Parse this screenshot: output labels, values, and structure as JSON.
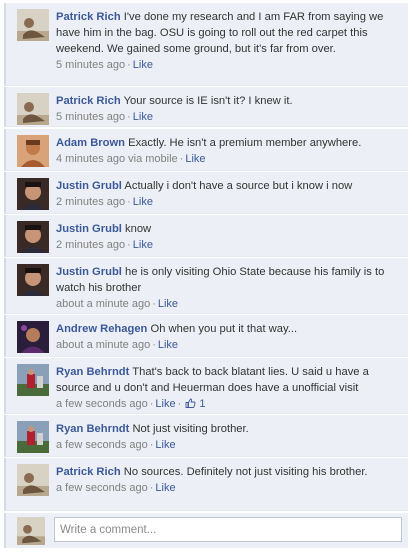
{
  "comments": [
    {
      "author": "Patrick Rich",
      "text": "I've done my research and I am FAR from saying we have him in the bag. OSU is going to roll out the red carpet this weekend. We gained some ground, but it's far from over.",
      "time": "5 minutes ago",
      "like": "Like",
      "avatar": "patrick-rich-avatar"
    },
    {
      "author": "Patrick Rich",
      "text": "Your source is IE isn't it? I knew it.",
      "time": "5 minutes ago",
      "like": "Like",
      "avatar": "patrick-rich-avatar"
    },
    {
      "author": "Adam Brown",
      "text": "Exactly. He isn't a premium member anywhere.",
      "time": "4 minutes ago via mobile",
      "like": "Like",
      "avatar": "adam-brown-avatar"
    },
    {
      "author": "Justin Grubl",
      "text": "Actually i don't have a source but i know i now",
      "time": "2 minutes ago",
      "like": "Like",
      "avatar": "justin-grubl-avatar"
    },
    {
      "author": "Justin Grubl",
      "text": "know",
      "time": "2 minutes ago",
      "like": "Like",
      "avatar": "justin-grubl-avatar"
    },
    {
      "author": "Justin Grubl",
      "text": "he is only visiting Ohio State because his family is to watch his brother",
      "time": "about a minute ago",
      "like": "Like",
      "avatar": "justin-grubl-avatar"
    },
    {
      "author": "Andrew Rehagen",
      "text": "Oh when you put it that way...",
      "time": "about a minute ago",
      "like": "Like",
      "avatar": "andrew-rehagen-avatar"
    },
    {
      "author": "Ryan Behrndt",
      "text": "That's back to back blatant lies. U said u have a source and u don't and Heuerman does have a unofficial visit",
      "time": "a few seconds ago",
      "like": "Like",
      "likes_count": "1",
      "avatar": "ryan-behrndt-avatar"
    },
    {
      "author": "Ryan Behrndt",
      "text": "Not just visiting brother.",
      "time": "a few seconds ago",
      "like": "Like",
      "avatar": "ryan-behrndt-avatar"
    },
    {
      "author": "Patrick Rich",
      "text": "No sources. Definitely not just visiting his brother.",
      "time": "a few seconds ago",
      "like": "Like",
      "avatar": "patrick-rich-avatar"
    }
  ],
  "composer": {
    "placeholder": "Write a comment..."
  },
  "colors": {
    "link": "#3b5998",
    "background": "#eceff5",
    "meta": "#808080"
  }
}
